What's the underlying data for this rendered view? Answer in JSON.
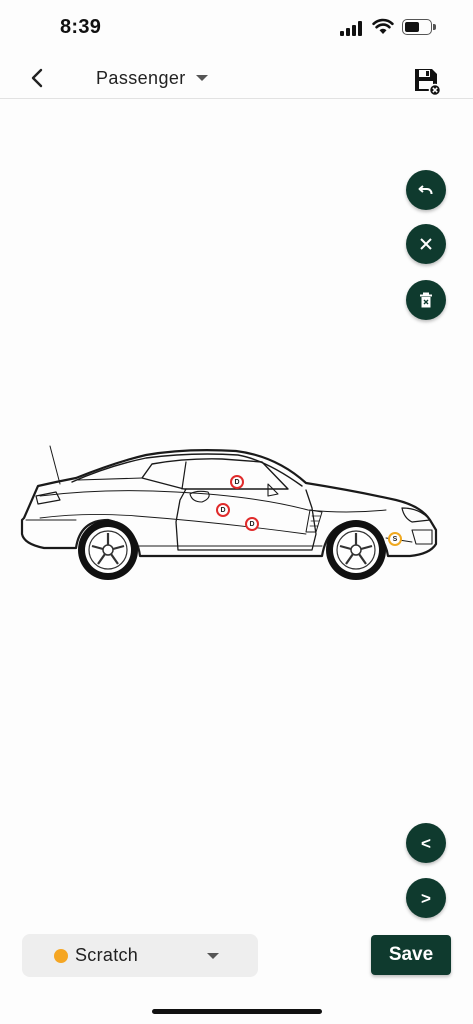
{
  "status_bar": {
    "time": "8:39",
    "signal_icon": "cellular-signal-icon",
    "wifi_icon": "wifi-icon",
    "battery_icon": "battery-icon",
    "battery_level": 0.6
  },
  "app_bar": {
    "back_icon": "chevron-left-icon",
    "view_label": "Passenger",
    "save_icon": "floppy-disk-icon"
  },
  "tools": {
    "undo_icon": "undo-icon",
    "clear_icon": "close-icon",
    "delete_icon": "trash-icon"
  },
  "markers": [
    {
      "code": "D",
      "type": "dent"
    },
    {
      "code": "D",
      "type": "dent"
    },
    {
      "code": "D",
      "type": "dent"
    },
    {
      "code": "S",
      "type": "scratch"
    }
  ],
  "navigation": {
    "prev_label": "<",
    "next_label": ">"
  },
  "damage_type": {
    "selected": "Scratch",
    "color": "#f5a623"
  },
  "save_label": "Save",
  "colors": {
    "primary": "#0f3a2e",
    "dent": "#e02b2b",
    "scratch": "#f0a920"
  }
}
